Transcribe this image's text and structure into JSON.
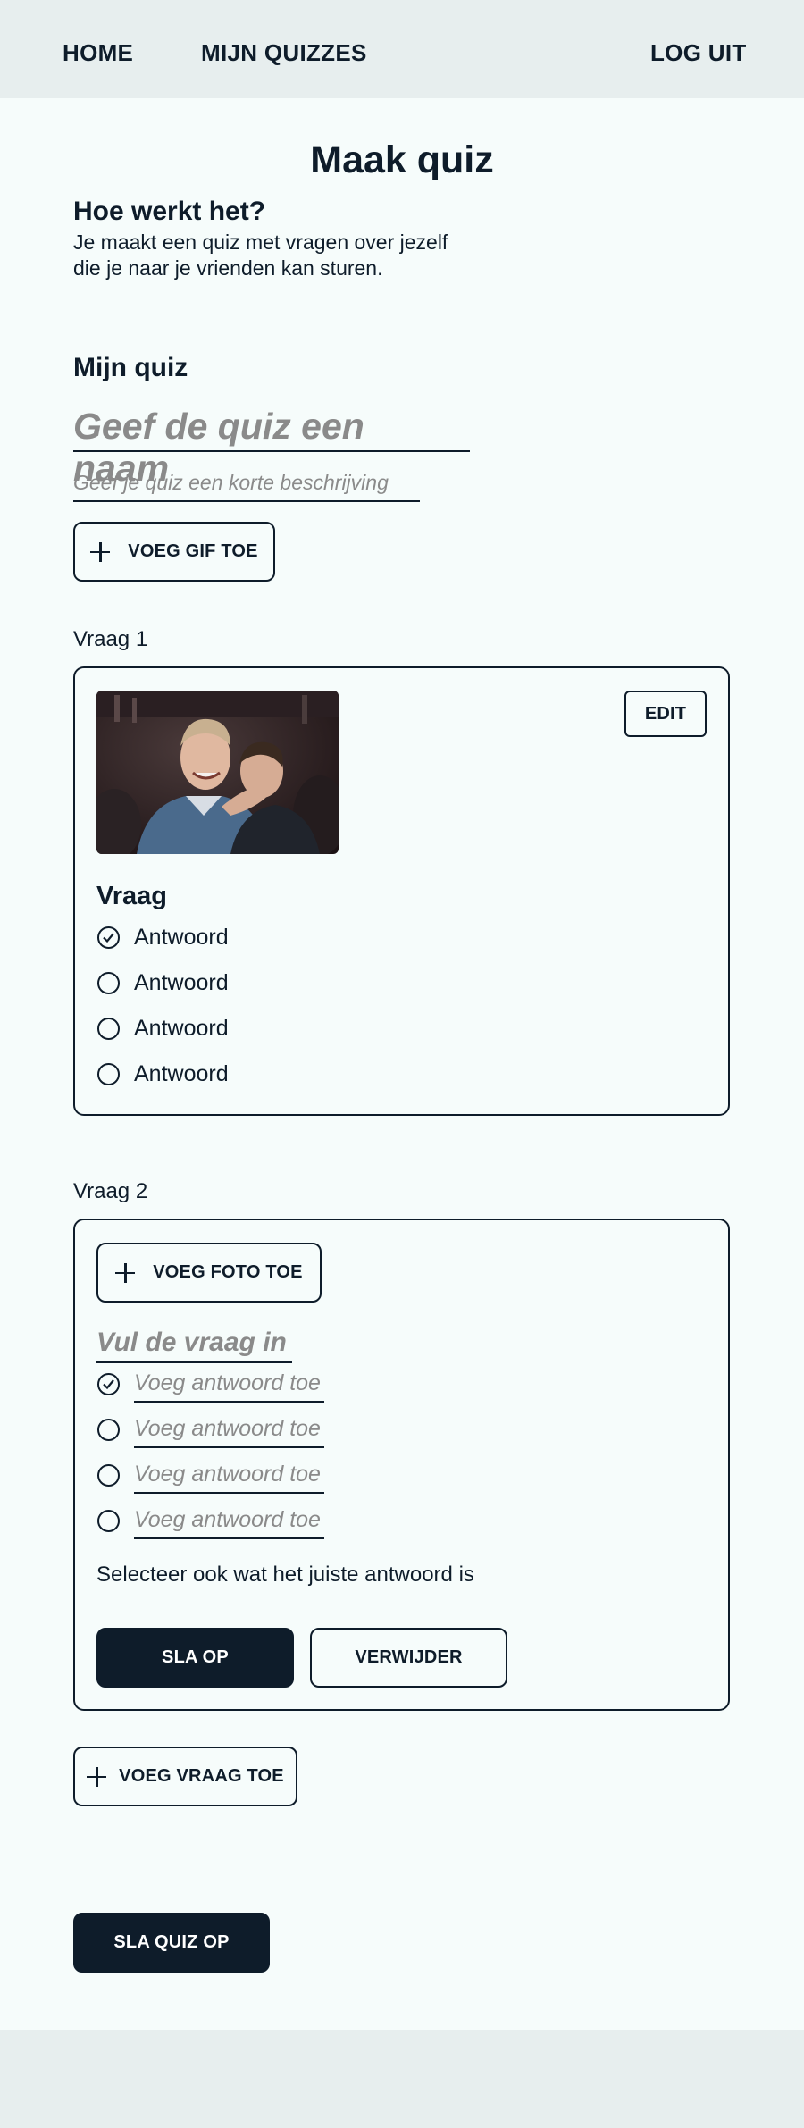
{
  "nav": {
    "home": "HOME",
    "my_quizzes": "MIJN QUIZZES",
    "logout": "LOG UIT"
  },
  "page": {
    "title": "Maak quiz",
    "how_title": "Hoe werkt het?",
    "how_line1": "Je maakt een quiz met vragen over jezelf",
    "how_line2": "die je naar je vrienden kan sturen."
  },
  "quiz": {
    "section_title": "Mijn quiz",
    "name_placeholder": "Geef de quiz een naam",
    "description_placeholder": "Geef je quiz een korte beschrijving",
    "add_gif_label": "VOEG GIF TOE"
  },
  "question1": {
    "label": "Vraag 1",
    "edit_label": "EDIT",
    "question": "Vraag",
    "answers": [
      "Antwoord",
      "Antwoord",
      "Antwoord",
      "Antwoord"
    ],
    "correct_index": 0
  },
  "question2": {
    "label": "Vraag 2",
    "add_photo_label": "VOEG FOTO TOE",
    "question_placeholder": "Vul de vraag in",
    "answer_placeholders": [
      "Voeg antwoord toe",
      "Voeg antwoord toe",
      "Voeg antwoord toe",
      "Voeg antwoord toe"
    ],
    "correct_index": 0,
    "hint": "Selecteer ook wat het juiste antwoord is",
    "save_label": "SLA OP",
    "delete_label": "VERWIJDER"
  },
  "actions": {
    "add_question_label": "VOEG VRAAG TOE",
    "save_quiz_label": "SLA QUIZ OP"
  },
  "colors": {
    "page_background": "#f6fcfb",
    "nav_background": "#e7eeee",
    "primary_dark": "#0e1c2a",
    "placeholder_gray": "#8a8a8a"
  }
}
